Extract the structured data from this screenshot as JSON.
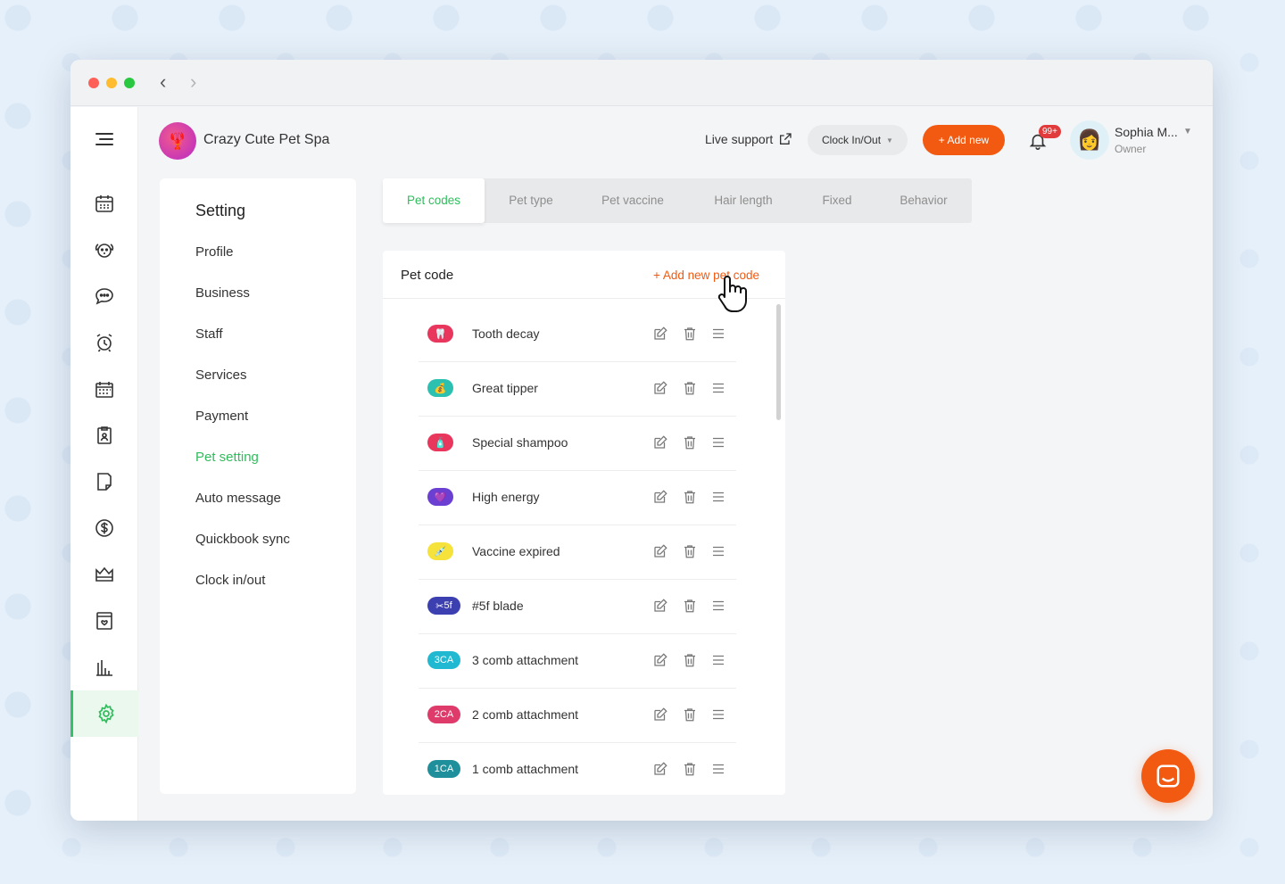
{
  "app": {
    "business_name": "Crazy Cute Pet Spa",
    "logo": "lobster-logo-icon"
  },
  "header": {
    "live_support": "Live support",
    "clock_button": "Clock In/Out",
    "add_new": "+ Add new",
    "notification_badge": "99+",
    "user_name": "Sophia M...",
    "user_role": "Owner"
  },
  "sidebar_icons": [
    "menu-icon",
    "calendar-icon",
    "pet-icon",
    "chat-icon",
    "alarm-icon",
    "schedule-icon",
    "clipboard-icon",
    "reports-icon",
    "dollar-icon",
    "crown-icon",
    "archive-icon",
    "analytics-icon",
    "settings-icon"
  ],
  "settings": {
    "title": "Setting",
    "items": [
      "Profile",
      "Business",
      "Staff",
      "Services",
      "Payment",
      "Pet setting",
      "Auto message",
      "Quickbook sync",
      "Clock in/out"
    ],
    "active": "Pet setting"
  },
  "tabs": [
    "Pet codes",
    "Pet type",
    "Pet vaccine",
    "Hair length",
    "Fixed",
    "Behavior"
  ],
  "active_tab": "Pet codes",
  "pet_code_card": {
    "title": "Pet code",
    "add_link": "+ Add new pet code",
    "codes": [
      {
        "label": "Tooth decay",
        "pill_text": "",
        "icon": "tooth-icon",
        "color": "#e8365d"
      },
      {
        "label": "Great tipper",
        "pill_text": "",
        "icon": "money-bag-icon",
        "color": "#2cc0b0"
      },
      {
        "label": "Special shampoo",
        "pill_text": "",
        "icon": "shampoo-bottle-icon",
        "color": "#e8365d"
      },
      {
        "label": "High energy",
        "pill_text": "",
        "icon": "heart-icon",
        "color": "#6a3fd1"
      },
      {
        "label": "Vaccine expired",
        "pill_text": "",
        "icon": "syringe-icon",
        "color": "#f5e23a"
      },
      {
        "label": "#5f blade",
        "pill_text": "5f",
        "icon": "scissors-icon",
        "color": "#3b3fb0"
      },
      {
        "label": "3 comb attachment",
        "pill_text": "3CA",
        "icon": "",
        "color": "#21b9d1"
      },
      {
        "label": "2 comb attachment",
        "pill_text": "2CA",
        "icon": "",
        "color": "#de3b6a"
      },
      {
        "label": "1 comb attachment",
        "pill_text": "1CA",
        "icon": "",
        "color": "#1f8f9b"
      }
    ]
  },
  "colors": {
    "accent_green": "#2fbd5c",
    "accent_orange": "#f25a12"
  }
}
